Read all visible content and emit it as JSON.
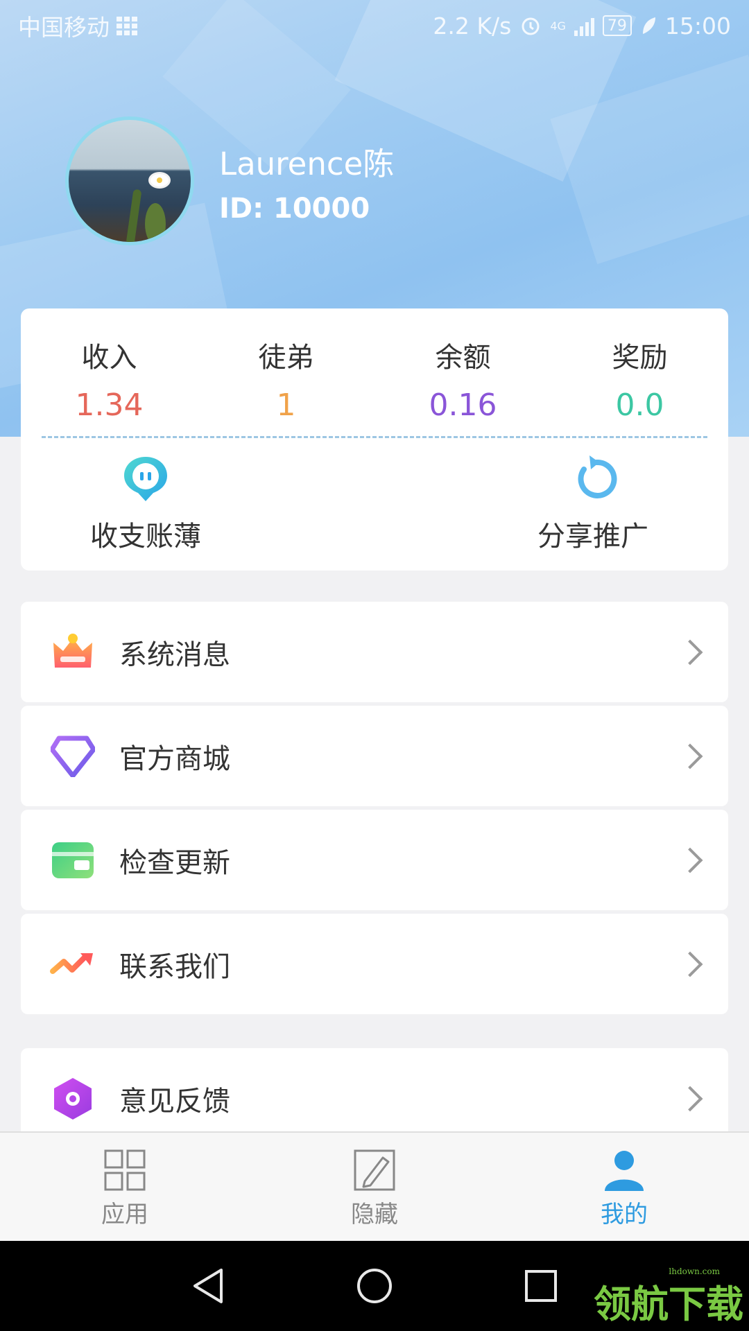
{
  "status_bar": {
    "carrier": "中国移动",
    "speed": "2.2 K/s",
    "network": "4G",
    "battery": "79",
    "time": "15:00"
  },
  "profile": {
    "username": "Laurence陈",
    "id": "ID: 10000"
  },
  "stats": [
    {
      "label": "收入",
      "value": "1.34",
      "color": "#e5675a"
    },
    {
      "label": "徒弟",
      "value": "1",
      "color": "#f0a24a"
    },
    {
      "label": "余额",
      "value": "0.16",
      "color": "#8a55d8"
    },
    {
      "label": "奖励",
      "value": "0.0",
      "color": "#3cc7a3"
    }
  ],
  "quick_actions": [
    {
      "label": "收支账薄",
      "icon": "chat-bubble-icon"
    },
    {
      "label": "分享推广",
      "icon": "refresh-arrow-icon"
    }
  ],
  "menu": [
    {
      "label": "系统消息",
      "icon": "crown-icon"
    },
    {
      "label": "官方商城",
      "icon": "diamond-icon"
    },
    {
      "label": "检查更新",
      "icon": "wallet-icon"
    },
    {
      "label": "联系我们",
      "icon": "trend-arrow-icon"
    },
    {
      "label": "意见反馈",
      "icon": "hexagon-icon"
    }
  ],
  "tabs": [
    {
      "label": "应用",
      "icon": "grid-icon",
      "active": false
    },
    {
      "label": "隐藏",
      "icon": "edit-icon",
      "active": false
    },
    {
      "label": "我的",
      "icon": "person-icon",
      "active": true
    }
  ],
  "colors": {
    "tab_active": "#2e9be0",
    "tab_inactive": "#888888"
  },
  "watermark": {
    "text": "领航下载",
    "site": "lhdown.com"
  }
}
